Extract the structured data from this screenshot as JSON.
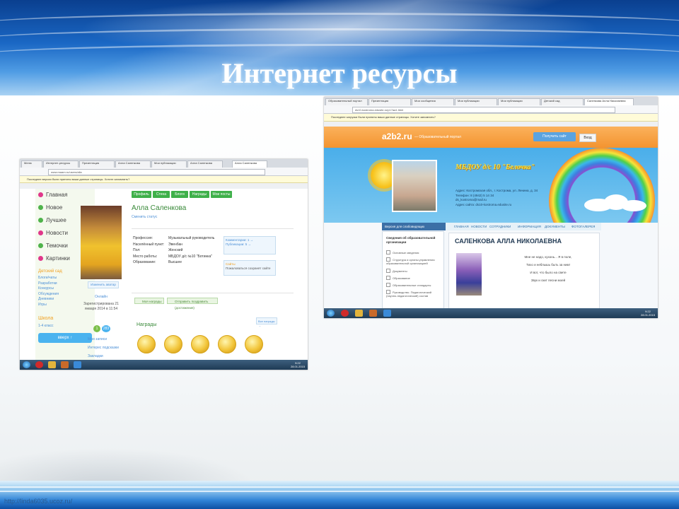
{
  "slide": {
    "title": "Интернет ресурсы",
    "footer_url": "http://linda6035.ucoz.ru/"
  },
  "colors": {
    "banner": "#1a67c4",
    "site_green": "#3fb04a",
    "portal_orange": "#f39430",
    "sky_blue": "#4aaeea",
    "school_title": "#f7e13c"
  },
  "screenshot_left": {
    "tabs": [
      "Меню",
      "Интернет-ресурсы",
      "Презентация",
      "Алла Саленкова",
      "Мои публикации",
      "Алла Саленкова",
      "Алла Саленкова"
    ],
    "address": "www.maam.ru/users/alla",
    "notice": "Последнее версии были приняты ваши данные страницы. Хотите запомнить?",
    "sidebar": {
      "items": [
        {
          "label": "Главная",
          "color": "#e0388a"
        },
        {
          "label": "Новое",
          "color": "#4fb34b"
        },
        {
          "label": "Лучшее",
          "color": "#4fb34b"
        },
        {
          "label": "Новости",
          "color": "#e0388a"
        },
        {
          "label": "Темочки",
          "color": "#4fb34b"
        },
        {
          "label": "Картинки",
          "color": "#e0388a"
        }
      ],
      "section": "Детский сад",
      "links": [
        "Блоги/чаты",
        "Разработки",
        "Конкурсы",
        "Обсуждения",
        "Дневники",
        "Игры"
      ],
      "school": "Школа",
      "school_link": "1-4 класс",
      "up_button": "вверх ↑"
    },
    "profile_tabs": [
      "Профиль",
      "Стена",
      "Блоги",
      "Награды",
      "Мои посты"
    ],
    "name": "Алла Саленкова",
    "subtitle": "Сменить статус",
    "fields": [
      {
        "label": "Профессия:",
        "value": "Музыкальный руководитель"
      },
      {
        "label": "Населённый пункт:",
        "value": "Эвенбан"
      },
      {
        "label": "Пол:",
        "value": "Женский"
      },
      {
        "label": "Место работы:",
        "value": "МБДОУ д/с №10 \"Ботинка\""
      },
      {
        "label": "Образование:",
        "value": "Высшее"
      }
    ],
    "stats_box": [
      "Комментарии: 1 →",
      "Публикации: 5 →"
    ],
    "sites_box": [
      "Сайты",
      "Пожаловаться сохранят сайте"
    ],
    "avatar_btn": "Изменить аватар",
    "online": "Онлайн",
    "joined": "Зарегистрирована 21 января 2014 в 11:54",
    "badges": [
      "1",
      "283"
    ],
    "side_links": [
      "Мои записи",
      "Интерес подсказки",
      "Закладки"
    ],
    "green_buttons": [
      "Моя награды",
      "Отправить поздравить (достижения)"
    ],
    "awards_title": "Награды",
    "awards_link": "Все награды →",
    "taskbar_time": "9:22",
    "taskbar_date": "28.01.2015"
  },
  "screenshot_right": {
    "tabs": [
      "Образовательный портал",
      "Презентация",
      "Мои сообщения",
      "Мои публикации",
      "Мои публикации",
      "Детский сад",
      "Саленкова Алла Николаевна"
    ],
    "address": "ds10-kostroma.edusite.ru/p17aa1.html",
    "notice": "Последнее загрузки были приняты ваши данные страницы. Хотите запомнить?",
    "logo": "a2b2.ru",
    "logo_sub": "— Образовательный портал",
    "create_button": "Получить сайт",
    "login_button": "Вход",
    "school_title": "МБДОУ д/с 10 \"Белочка\"",
    "address_lines": [
      "Адрес: Костромская обл., г. Кострома, ул. Ленина, д. 34",
      "Телефон: 8 (4942) 5 14 34",
      "ds_kostroma@mail.ru",
      "Адрес сайта: ds10-kostroma.edusite.ru"
    ],
    "menu_left": "Версия для слабовидящих",
    "menu_main": [
      "ГЛАВНАЯ",
      "НОВОСТИ",
      "СОТРУДНИКИ",
      "ИНФОРМАЦИЯ",
      "ДОКУМЕНТЫ",
      "ФОТОГАЛЕРЕЯ"
    ],
    "list_header": "Сведения об образовательной организации",
    "list_items": [
      "Основные сведения",
      "Структура и органы управления образовательной организацией",
      "Документы",
      "Образование",
      "Образовательные стандарты",
      "Руководство. Педагогический (научно-педагогический) состав"
    ],
    "heading": "САЛЕНКОВА АЛЛА НИКОЛАЕВНА",
    "content_lines": [
      "Мне не надо, кухонь... Я в поле,",
      "Тихо и неблышь быть за ним!",
      "И вот, что было на свете",
      "Звук и скит песни моей"
    ],
    "taskbar_time": "9:22",
    "taskbar_date": "28.01.2015"
  }
}
